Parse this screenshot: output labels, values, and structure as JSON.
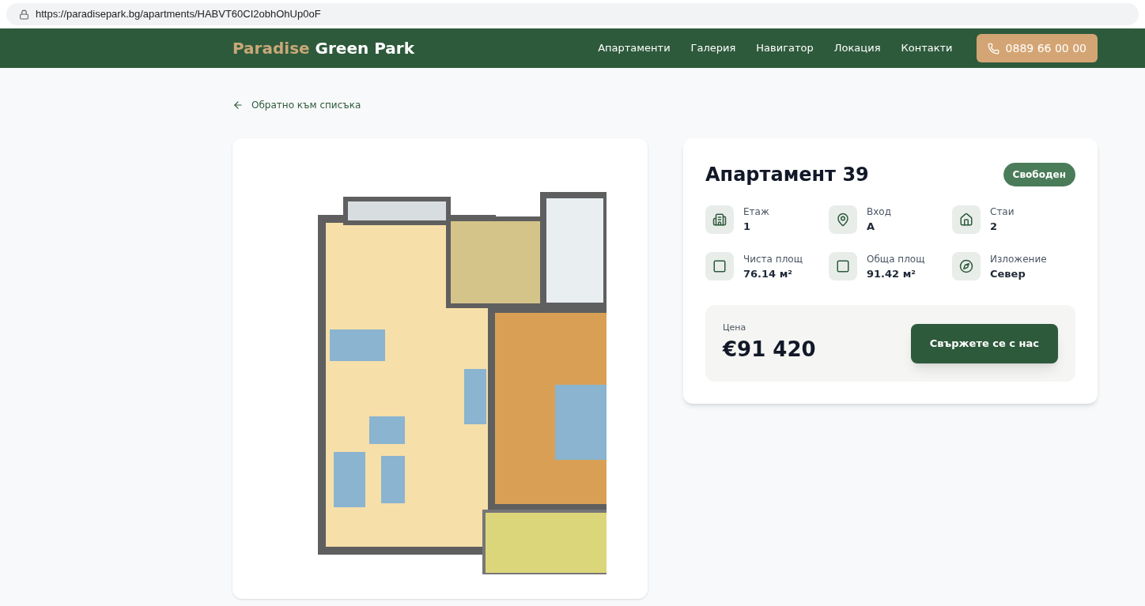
{
  "address_bar": {
    "url": "https://paradisepark.bg/apartments/HABVT60CI2obhOhUp0oF"
  },
  "header": {
    "logo_accent": "Paradise",
    "logo_rest": "Green Park",
    "nav": [
      "Апартаменти",
      "Галерия",
      "Навигатор",
      "Локация",
      "Контакти"
    ],
    "phone": "0889 66 00 00"
  },
  "back_link": "Обратно към списъка",
  "apartment": {
    "title": "Апартамент 39",
    "status": "Свободен",
    "specs": [
      {
        "label": "Етаж",
        "value": "1"
      },
      {
        "label": "Вход",
        "value": "A"
      },
      {
        "label": "Стаи",
        "value": "2"
      },
      {
        "label": "Чиста площ",
        "value": "76.14 м²"
      },
      {
        "label": "Обща площ",
        "value": "91.42 м²"
      },
      {
        "label": "Изложение",
        "value": "Север"
      }
    ],
    "price_label": "Цена",
    "price": "€91 420",
    "contact_button": "Свържете се с нас"
  }
}
